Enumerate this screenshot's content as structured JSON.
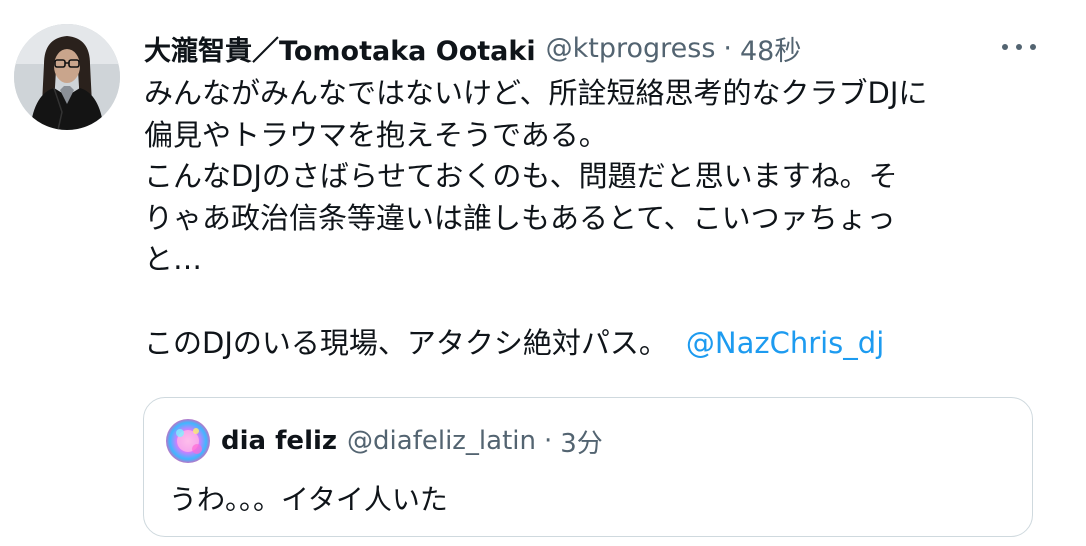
{
  "tweet": {
    "display_name": "大瀧智貴／Tomotaka Ootaki",
    "handle": "@ktprogress",
    "separator": "·",
    "time": "48秒",
    "more_icon": "more-horizontal-icon",
    "body_lines": [
      "みんながみんなではないけど、所詮短絡思考的なクラブDJに",
      "偏見やトラウマを抱えそうである。",
      "こんなDJのさばらせておくのも、問題だと思いますね。そ",
      "りゃあ政治信条等違いは誰しもあるとて、こいつァちょっ",
      "と…",
      "",
      "このDJのいる現場、アタクシ絶対パス。"
    ],
    "mention": "@NazChris_dj",
    "colors": {
      "mention": "#1d9bf0",
      "secondary_text": "#536471",
      "border": "#cfd9de"
    }
  },
  "quoted_tweet": {
    "display_name": "dia feliz",
    "handle": "@diafeliz_latin",
    "separator": "·",
    "time": "3分",
    "text": "うわ。。。イタイ人いた"
  }
}
